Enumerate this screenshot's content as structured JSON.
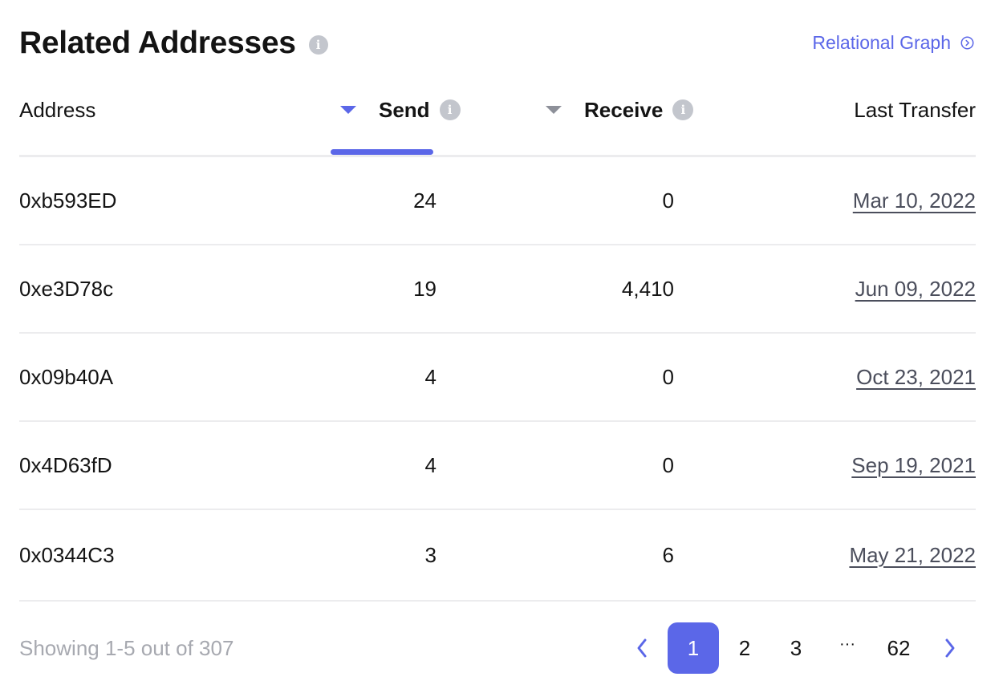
{
  "header": {
    "title": "Related Addresses",
    "info_icon": "info-icon",
    "graph_link": "Relational Graph",
    "graph_link_icon": "circle-chevron-right-icon"
  },
  "colors": {
    "accent": "#5b67e8",
    "text": "#141414",
    "muted": "#a7a9b0",
    "divider": "#ececee"
  },
  "table": {
    "columns": {
      "address": "Address",
      "send": "Send",
      "receive": "Receive",
      "last_transfer": "Last Transfer"
    },
    "sorted_by": "Send",
    "rows": [
      {
        "address": "0xb593ED",
        "send": "24",
        "receive": "0",
        "last_transfer": "Mar 10, 2022"
      },
      {
        "address": "0xe3D78c",
        "send": "19",
        "receive": "4,410",
        "last_transfer": "Jun 09, 2022"
      },
      {
        "address": "0x09b40A",
        "send": "4",
        "receive": "0",
        "last_transfer": "Oct 23, 2021"
      },
      {
        "address": "0x4D63fD",
        "send": "4",
        "receive": "0",
        "last_transfer": "Sep 19, 2021"
      },
      {
        "address": "0x0344C3",
        "send": "3",
        "receive": "6",
        "last_transfer": "May 21, 2022"
      }
    ]
  },
  "pagination": {
    "showing": "Showing 1-5 out of 307",
    "pages": [
      "1",
      "2",
      "3",
      "...",
      "62"
    ],
    "ellipsis": "···",
    "current": "1"
  }
}
